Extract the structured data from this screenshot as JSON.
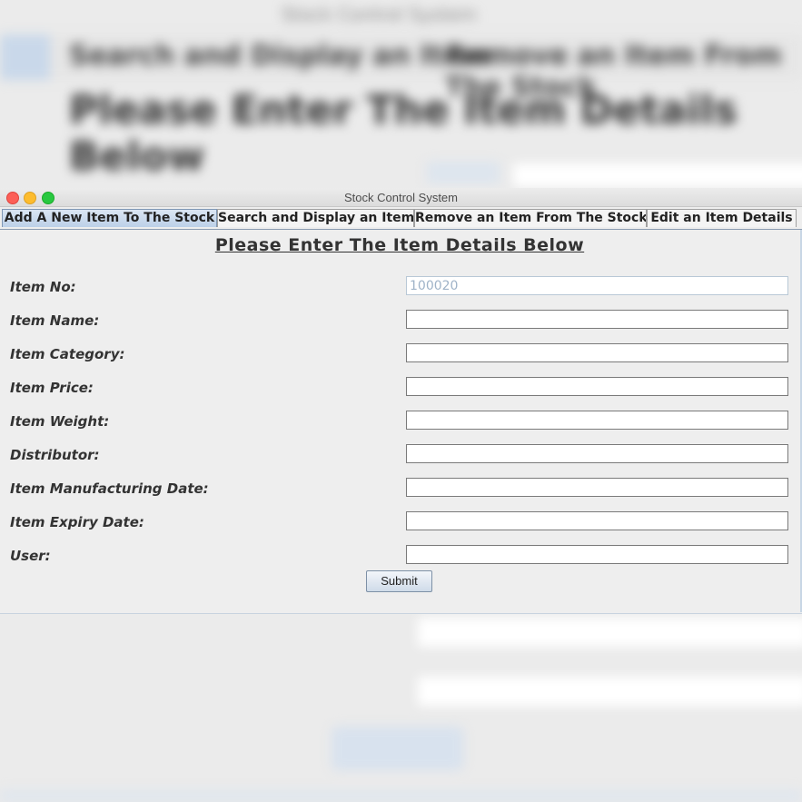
{
  "window": {
    "title": "Stock Control System"
  },
  "tabs": [
    {
      "label": "Add A New Item To The Stock",
      "selected": true
    },
    {
      "label": "Search and Display an Item",
      "selected": false
    },
    {
      "label": "Remove an Item From The Stock",
      "selected": false
    },
    {
      "label": "Edit an Item Details",
      "selected": false
    }
  ],
  "form": {
    "heading": "Please Enter The Item Details Below",
    "fields": [
      {
        "label": "Item No:",
        "value": "100020",
        "editable": false
      },
      {
        "label": "Item Name:",
        "value": ""
      },
      {
        "label": "Item Category:",
        "value": ""
      },
      {
        "label": "Item Price:",
        "value": ""
      },
      {
        "label": "Item Weight:",
        "value": ""
      },
      {
        "label": "Distributor:",
        "value": ""
      },
      {
        "label": "Item Manufacturing Date:",
        "value": ""
      },
      {
        "label": "Item Expiry Date:",
        "value": ""
      },
      {
        "label": "User:",
        "value": ""
      }
    ],
    "submit_label": "Submit"
  },
  "background": {
    "tab1": "Search and Display an Item",
    "tab2": "Remove an Item From The Stock",
    "heading": "Please Enter The Item Details Below"
  },
  "colors": {
    "selected_tab": "#bcd0e8",
    "window_bg": "#eeeeee",
    "close": "#fc5f57",
    "minimize": "#fdbc2e",
    "maximize": "#28c840"
  }
}
